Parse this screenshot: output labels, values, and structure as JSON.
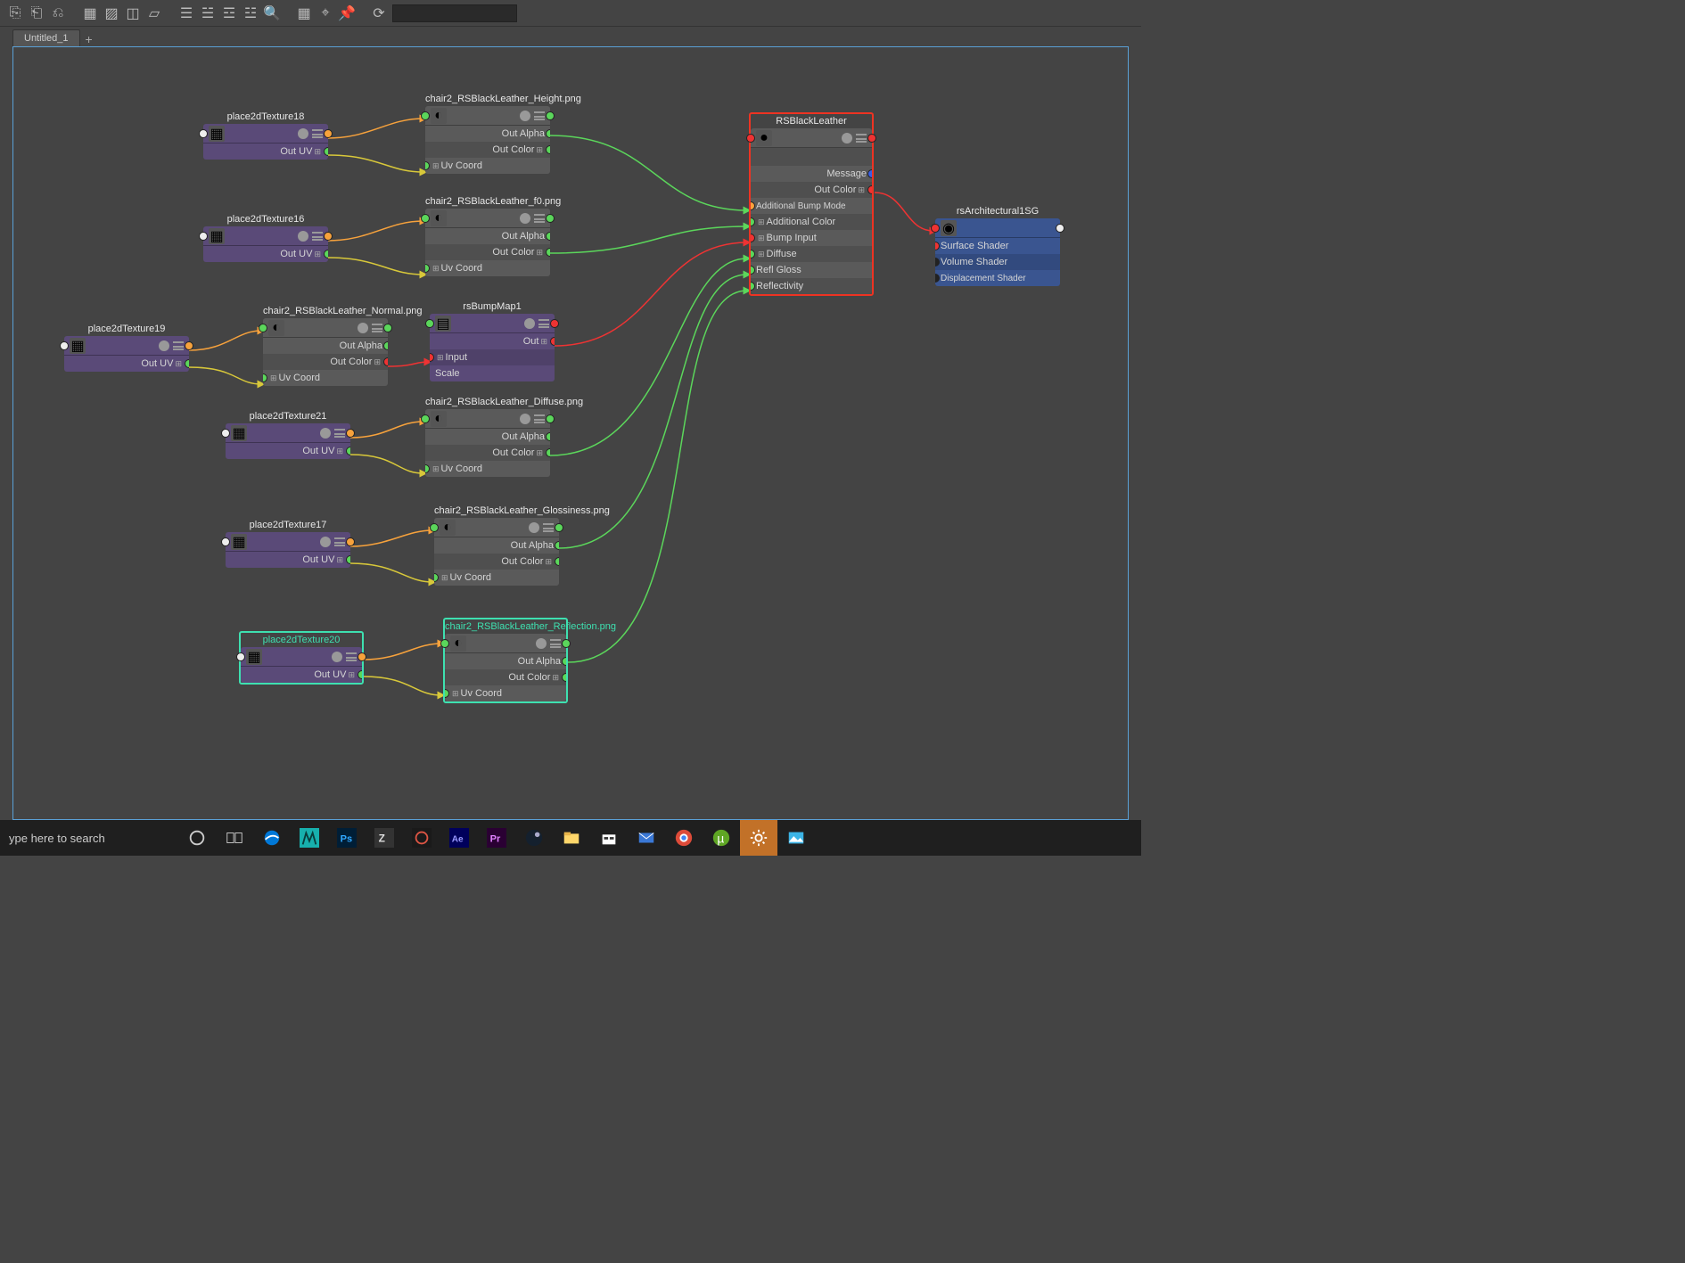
{
  "tab": {
    "name": "Untitled_1"
  },
  "search_placeholder": "ype here to search",
  "nodes": {
    "p18": {
      "title": "place2dTexture18",
      "out": "Out UV"
    },
    "p16": {
      "title": "place2dTexture16",
      "out": "Out UV"
    },
    "p19": {
      "title": "place2dTexture19",
      "out": "Out UV"
    },
    "p21": {
      "title": "place2dTexture21",
      "out": "Out UV"
    },
    "p17": {
      "title": "place2dTexture17",
      "out": "Out UV"
    },
    "p20": {
      "title": "place2dTexture20",
      "out": "Out UV"
    },
    "height": {
      "title": "chair2_RSBlackLeather_Height.png",
      "r1": "Out Alpha",
      "r2": "Out Color",
      "r3": "Uv Coord"
    },
    "f0": {
      "title": "chair2_RSBlackLeather_f0.png",
      "r1": "Out Alpha",
      "r2": "Out Color",
      "r3": "Uv Coord"
    },
    "normal": {
      "title": "chair2_RSBlackLeather_Normal.png",
      "r1": "Out Alpha",
      "r2": "Out Color",
      "r3": "Uv Coord"
    },
    "bump": {
      "title": "rsBumpMap1",
      "r1": "Out",
      "r2": "Input",
      "r3": "Scale"
    },
    "diffuse": {
      "title": "chair2_RSBlackLeather_Diffuse.png",
      "r1": "Out Alpha",
      "r2": "Out Color",
      "r3": "Uv Coord"
    },
    "gloss": {
      "title": "chair2_RSBlackLeather_Glossiness.png",
      "r1": "Out Alpha",
      "r2": "Out Color",
      "r3": "Uv Coord"
    },
    "refl": {
      "title": "chair2_RSBlackLeather_Reflection.png",
      "r1": "Out Alpha",
      "r2": "Out Color",
      "r3": "Uv Coord"
    },
    "mat": {
      "title": "RSBlackLeather",
      "r1": "Message",
      "r2": "Out Color",
      "r3": "Additional Bump Mode",
      "r4": "Additional Color",
      "r5": "Bump Input",
      "r6": "Diffuse",
      "r7": "Refl Gloss",
      "r8": "Reflectivity"
    },
    "sg": {
      "title": "rsArchitectural1SG",
      "r1": "Surface Shader",
      "r2": "Volume Shader",
      "r3": "Displacement Shader"
    }
  },
  "taskbar_apps": [
    "edge",
    "maya",
    "photoshop",
    "zbrush",
    "substance",
    "aftereffects",
    "premiere",
    "steam",
    "explorer",
    "store",
    "mail",
    "chrome",
    "utorrent",
    "settings",
    "photos"
  ]
}
